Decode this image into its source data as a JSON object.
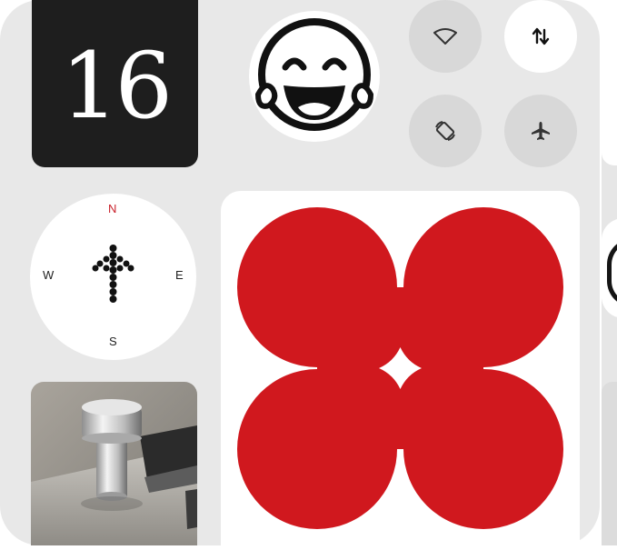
{
  "date_widget": {
    "day": "16"
  },
  "emoji_widget": {
    "icon": "face-with-tears-of-joy-icon"
  },
  "quick_settings": [
    {
      "icon": "wifi-icon",
      "state": "off"
    },
    {
      "icon": "data-transfer-icon",
      "state": "on"
    },
    {
      "icon": "auto-rotate-icon",
      "state": "off"
    },
    {
      "icon": "airplane-mode-icon",
      "state": "off"
    }
  ],
  "compass_widget": {
    "north": "N",
    "south": "S",
    "west": "W",
    "east": "E"
  },
  "photo_widget": {
    "subject": "table-lamp-photo"
  },
  "clover_widget": {
    "icon": "four-leaf-clover-shape",
    "color": "#d0181e"
  },
  "colors": {
    "panel": "#e8e8e8",
    "dark_tile": "#1e1e1e",
    "accent_red": "#d0181e",
    "north_red": "#c9202a"
  }
}
